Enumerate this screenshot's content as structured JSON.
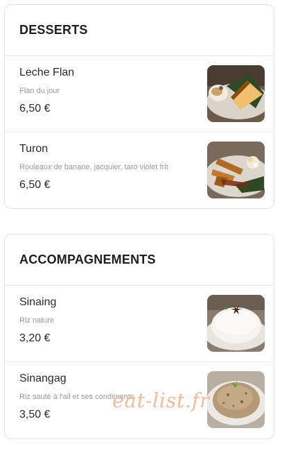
{
  "sections": [
    {
      "title": "DESSERTS",
      "items": [
        {
          "name": "Leche Flan",
          "description": "Flan du jour",
          "price": "6,50 €",
          "image": "leche-flan-photo"
        },
        {
          "name": "Turon",
          "description": "Rouleaux de banane, jacquier, taro violet frit",
          "price": "6,50 €",
          "image": "turon-photo"
        }
      ]
    },
    {
      "title": "ACCOMPAGNEMENTS",
      "items": [
        {
          "name": "Sinaing",
          "description": "Riz nature",
          "price": "3,20 €",
          "image": "sinaing-photo"
        },
        {
          "name": "Sinangag",
          "description": "Riz sauté à l'ail et ses condiments",
          "price": "3,50 €",
          "image": "sinangag-photo"
        }
      ]
    }
  ],
  "watermark": "eat-list.fr",
  "colors": {
    "border": "#e3e3e3",
    "text": "#222222",
    "muted": "#9a9a9a",
    "watermark": "#f2b48e"
  }
}
